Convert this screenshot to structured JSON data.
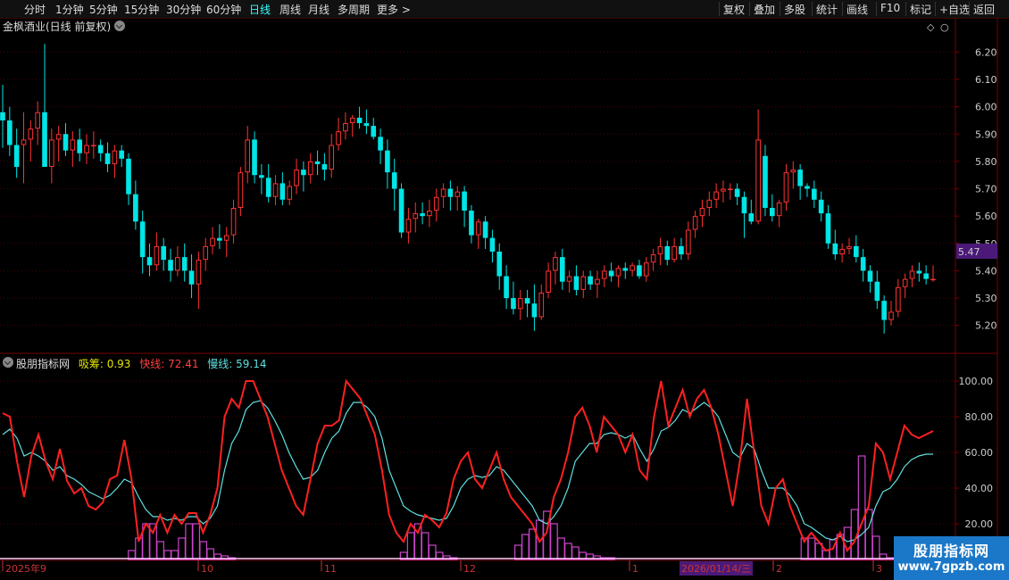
{
  "toolbar": {
    "periods": [
      "分时",
      "1分钟",
      "5分钟",
      "15分钟",
      "30分钟",
      "60分钟",
      "日线",
      "周线",
      "月线",
      "多周期",
      "更多 >"
    ],
    "active_period": "日线",
    "right_buttons": [
      "复权",
      "叠加",
      "多股",
      "统计",
      "画线",
      "F10",
      "标记",
      "+自选",
      "返回"
    ]
  },
  "stock": {
    "title": "金枫酒业(日线 前复权)",
    "current_price_label": "5.47"
  },
  "indicator": {
    "name": "股朋指标网",
    "xichou_label": "吸筹: 0.93",
    "fast_label": "快线: 72.41",
    "slow_label": "慢线: 59.14"
  },
  "x_axis": {
    "labels": [
      "2025年9",
      "10",
      "11",
      "12",
      "1",
      "2",
      "3"
    ],
    "highlight_date": "2026/01/14/三"
  },
  "watermark": {
    "name": "股朋指标网",
    "url": "www.7gpzb.com"
  },
  "colors": {
    "up": "#ff3232",
    "down": "#00e5e5",
    "fast": "#ff2020",
    "slow": "#5fe0e0",
    "xichou": "#cc44cc",
    "grid": "#4a0000"
  },
  "chart_data": [
    {
      "type": "candlestick",
      "title": "金枫酒业(日线 前复权)",
      "y_ticks": [
        5.2,
        5.3,
        5.4,
        5.5,
        5.6,
        5.7,
        5.8,
        5.9,
        6.0,
        6.1,
        6.2
      ],
      "ylim": [
        5.15,
        6.26
      ],
      "candles": [
        [
          5.98,
          6.08,
          5.85,
          5.95
        ],
        [
          5.95,
          6.0,
          5.82,
          5.86
        ],
        [
          5.86,
          5.92,
          5.74,
          5.78
        ],
        [
          5.86,
          5.98,
          5.72,
          5.88
        ],
        [
          5.88,
          5.95,
          5.8,
          5.92
        ],
        [
          5.92,
          6.02,
          5.86,
          5.98
        ],
        [
          5.98,
          6.23,
          5.86,
          5.78
        ],
        [
          5.78,
          5.92,
          5.72,
          5.88
        ],
        [
          5.88,
          5.93,
          5.8,
          5.9
        ],
        [
          5.9,
          5.94,
          5.82,
          5.84
        ],
        [
          5.84,
          5.91,
          5.78,
          5.88
        ],
        [
          5.88,
          5.92,
          5.8,
          5.83
        ],
        [
          5.83,
          5.9,
          5.79,
          5.86
        ],
        [
          5.86,
          5.91,
          5.81,
          5.86
        ],
        [
          5.86,
          5.88,
          5.8,
          5.83
        ],
        [
          5.83,
          5.87,
          5.76,
          5.79
        ],
        [
          5.79,
          5.86,
          5.74,
          5.84
        ],
        [
          5.84,
          5.86,
          5.78,
          5.81
        ],
        [
          5.81,
          5.83,
          5.64,
          5.68
        ],
        [
          5.68,
          5.73,
          5.55,
          5.58
        ],
        [
          5.58,
          5.62,
          5.39,
          5.45
        ],
        [
          5.45,
          5.5,
          5.38,
          5.42
        ],
        [
          5.42,
          5.54,
          5.4,
          5.49
        ],
        [
          5.49,
          5.52,
          5.4,
          5.44
        ],
        [
          5.44,
          5.48,
          5.36,
          5.4
        ],
        [
          5.4,
          5.49,
          5.38,
          5.45
        ],
        [
          5.45,
          5.5,
          5.36,
          5.4
        ],
        [
          5.4,
          5.46,
          5.3,
          5.35
        ],
        [
          5.35,
          5.47,
          5.26,
          5.44
        ],
        [
          5.44,
          5.52,
          5.4,
          5.49
        ],
        [
          5.49,
          5.56,
          5.46,
          5.52
        ],
        [
          5.52,
          5.57,
          5.48,
          5.51
        ],
        [
          5.51,
          5.56,
          5.45,
          5.53
        ],
        [
          5.53,
          5.66,
          5.5,
          5.63
        ],
        [
          5.63,
          5.78,
          5.6,
          5.76
        ],
        [
          5.76,
          5.93,
          5.72,
          5.88
        ],
        [
          5.88,
          5.91,
          5.72,
          5.75
        ],
        [
          5.75,
          5.79,
          5.68,
          5.74
        ],
        [
          5.74,
          5.79,
          5.65,
          5.67
        ],
        [
          5.67,
          5.75,
          5.64,
          5.72
        ],
        [
          5.72,
          5.76,
          5.64,
          5.66
        ],
        [
          5.66,
          5.73,
          5.64,
          5.71
        ],
        [
          5.71,
          5.81,
          5.68,
          5.77
        ],
        [
          5.77,
          5.8,
          5.69,
          5.75
        ],
        [
          5.75,
          5.83,
          5.72,
          5.8
        ],
        [
          5.8,
          5.84,
          5.75,
          5.79
        ],
        [
          5.79,
          5.83,
          5.73,
          5.77
        ],
        [
          5.77,
          5.9,
          5.74,
          5.86
        ],
        [
          5.86,
          5.96,
          5.84,
          5.91
        ],
        [
          5.91,
          5.98,
          5.88,
          5.94
        ],
        [
          5.94,
          5.97,
          5.89,
          5.96
        ],
        [
          5.96,
          6.0,
          5.92,
          5.94
        ],
        [
          5.94,
          5.99,
          5.9,
          5.93
        ],
        [
          5.93,
          5.96,
          5.88,
          5.89
        ],
        [
          5.89,
          5.92,
          5.79,
          5.84
        ],
        [
          5.84,
          5.88,
          5.7,
          5.76
        ],
        [
          5.76,
          5.81,
          5.62,
          5.7
        ],
        [
          5.7,
          5.72,
          5.52,
          5.54
        ],
        [
          5.54,
          5.63,
          5.5,
          5.59
        ],
        [
          5.59,
          5.65,
          5.54,
          5.61
        ],
        [
          5.61,
          5.65,
          5.57,
          5.6
        ],
        [
          5.6,
          5.66,
          5.56,
          5.62
        ],
        [
          5.62,
          5.7,
          5.58,
          5.67
        ],
        [
          5.67,
          5.72,
          5.63,
          5.7
        ],
        [
          5.7,
          5.73,
          5.62,
          5.67
        ],
        [
          5.67,
          5.71,
          5.62,
          5.69
        ],
        [
          5.69,
          5.71,
          5.56,
          5.62
        ],
        [
          5.62,
          5.64,
          5.5,
          5.53
        ],
        [
          5.53,
          5.59,
          5.48,
          5.58
        ],
        [
          5.58,
          5.6,
          5.48,
          5.52
        ],
        [
          5.52,
          5.55,
          5.43,
          5.47
        ],
        [
          5.47,
          5.5,
          5.33,
          5.38
        ],
        [
          5.38,
          5.42,
          5.26,
          5.3
        ],
        [
          5.3,
          5.36,
          5.24,
          5.26
        ],
        [
          5.26,
          5.33,
          5.22,
          5.3
        ],
        [
          5.3,
          5.33,
          5.23,
          5.28
        ],
        [
          5.28,
          5.35,
          5.18,
          5.23
        ],
        [
          5.23,
          5.35,
          5.22,
          5.32
        ],
        [
          5.32,
          5.43,
          5.3,
          5.4
        ],
        [
          5.4,
          5.47,
          5.35,
          5.45
        ],
        [
          5.45,
          5.48,
          5.33,
          5.36
        ],
        [
          5.36,
          5.4,
          5.32,
          5.38
        ],
        [
          5.38,
          5.42,
          5.31,
          5.33
        ],
        [
          5.33,
          5.4,
          5.3,
          5.38
        ],
        [
          5.38,
          5.4,
          5.33,
          5.35
        ],
        [
          5.35,
          5.4,
          5.3,
          5.37
        ],
        [
          5.37,
          5.42,
          5.34,
          5.4
        ],
        [
          5.4,
          5.43,
          5.36,
          5.38
        ],
        [
          5.38,
          5.42,
          5.34,
          5.41
        ],
        [
          5.41,
          5.43,
          5.37,
          5.4
        ],
        [
          5.4,
          5.43,
          5.38,
          5.42
        ],
        [
          5.42,
          5.44,
          5.37,
          5.38
        ],
        [
          5.38,
          5.45,
          5.36,
          5.43
        ],
        [
          5.43,
          5.48,
          5.4,
          5.46
        ],
        [
          5.46,
          5.52,
          5.42,
          5.49
        ],
        [
          5.49,
          5.51,
          5.42,
          5.44
        ],
        [
          5.44,
          5.52,
          5.43,
          5.49
        ],
        [
          5.49,
          5.52,
          5.44,
          5.46
        ],
        [
          5.46,
          5.58,
          5.44,
          5.55
        ],
        [
          5.55,
          5.62,
          5.52,
          5.6
        ],
        [
          5.6,
          5.66,
          5.56,
          5.63
        ],
        [
          5.63,
          5.69,
          5.6,
          5.66
        ],
        [
          5.66,
          5.72,
          5.63,
          5.69
        ],
        [
          5.69,
          5.73,
          5.65,
          5.7
        ],
        [
          5.7,
          5.72,
          5.66,
          5.7
        ],
        [
          5.7,
          5.72,
          5.64,
          5.67
        ],
        [
          5.67,
          5.69,
          5.52,
          5.61
        ],
        [
          5.61,
          5.66,
          5.57,
          5.58
        ],
        [
          5.58,
          5.99,
          5.57,
          5.88
        ],
        [
          5.82,
          5.86,
          5.6,
          5.63
        ],
        [
          5.63,
          5.68,
          5.58,
          5.6
        ],
        [
          5.6,
          5.66,
          5.56,
          5.65
        ],
        [
          5.65,
          5.79,
          5.62,
          5.76
        ],
        [
          5.76,
          5.8,
          5.7,
          5.77
        ],
        [
          5.77,
          5.79,
          5.66,
          5.71
        ],
        [
          5.71,
          5.72,
          5.67,
          5.7
        ],
        [
          5.7,
          5.73,
          5.63,
          5.66
        ],
        [
          5.66,
          5.69,
          5.58,
          5.61
        ],
        [
          5.61,
          5.64,
          5.48,
          5.5
        ],
        [
          5.5,
          5.55,
          5.44,
          5.46
        ],
        [
          5.46,
          5.5,
          5.43,
          5.48
        ],
        [
          5.48,
          5.52,
          5.46,
          5.49
        ],
        [
          5.49,
          5.53,
          5.43,
          5.45
        ],
        [
          5.45,
          5.48,
          5.36,
          5.4
        ],
        [
          5.4,
          5.42,
          5.32,
          5.36
        ],
        [
          5.36,
          5.4,
          5.26,
          5.29
        ],
        [
          5.29,
          5.31,
          5.17,
          5.22
        ],
        [
          5.22,
          5.29,
          5.2,
          5.25
        ],
        [
          5.25,
          5.37,
          5.23,
          5.34
        ],
        [
          5.34,
          5.39,
          5.3,
          5.37
        ],
        [
          5.37,
          5.42,
          5.34,
          5.4
        ],
        [
          5.4,
          5.43,
          5.36,
          5.39
        ],
        [
          5.39,
          5.42,
          5.35,
          5.37
        ],
        [
          5.37,
          5.42,
          5.36,
          5.37
        ]
      ]
    },
    {
      "type": "line",
      "title": "股朋指标网",
      "y_ticks": [
        20,
        40,
        60,
        80,
        100
      ],
      "ylim": [
        0,
        105
      ],
      "series": [
        {
          "name": "快线",
          "values": [
            82,
            80,
            55,
            35,
            58,
            70,
            55,
            45,
            62,
            44,
            37,
            40,
            30,
            28,
            32,
            45,
            47,
            67,
            45,
            10,
            20,
            15,
            25,
            15,
            25,
            20,
            26,
            26,
            15,
            25,
            40,
            80,
            90,
            85,
            100,
            100,
            90,
            80,
            65,
            50,
            40,
            30,
            25,
            45,
            65,
            75,
            75,
            78,
            100,
            95,
            90,
            80,
            70,
            50,
            25,
            15,
            10,
            20,
            15,
            25,
            22,
            18,
            26,
            45,
            55,
            60,
            45,
            40,
            50,
            60,
            45,
            35,
            30,
            25,
            20,
            10,
            15,
            35,
            45,
            60,
            80,
            85,
            75,
            60,
            80,
            75,
            70,
            60,
            70,
            50,
            45,
            80,
            100,
            75,
            85,
            95,
            80,
            90,
            95,
            85,
            70,
            50,
            30,
            55,
            90,
            60,
            30,
            20,
            40,
            45,
            30,
            20,
            10,
            15,
            10,
            5,
            6,
            15,
            5,
            10,
            20,
            30,
            65,
            60,
            45,
            60,
            75,
            70,
            68,
            70,
            72
          ]
        },
        {
          "name": "慢线",
          "values": [
            70,
            73,
            68,
            58,
            60,
            58,
            55,
            50,
            52,
            47,
            45,
            42,
            38,
            36,
            34,
            36,
            40,
            45,
            43,
            35,
            28,
            24,
            24,
            22,
            23,
            22,
            24,
            24,
            20,
            23,
            30,
            50,
            65,
            72,
            84,
            88,
            89,
            85,
            78,
            70,
            60,
            52,
            45,
            46,
            50,
            60,
            68,
            72,
            82,
            88,
            88,
            85,
            80,
            68,
            50,
            40,
            30,
            27,
            25,
            24,
            23,
            22,
            23,
            30,
            40,
            45,
            47,
            46,
            47,
            52,
            50,
            45,
            40,
            35,
            30,
            22,
            20,
            24,
            30,
            40,
            55,
            60,
            65,
            65,
            70,
            71,
            70,
            68,
            70,
            62,
            55,
            62,
            72,
            74,
            78,
            84,
            82,
            85,
            88,
            85,
            80,
            70,
            60,
            57,
            65,
            62,
            50,
            40,
            40,
            40,
            36,
            30,
            20,
            18,
            15,
            12,
            11,
            13,
            10,
            11,
            14,
            18,
            30,
            38,
            40,
            45,
            52,
            56,
            58,
            59,
            59
          ]
        },
        {
          "name": "吸筹",
          "type": "bar",
          "values": [
            0,
            0,
            0,
            0,
            0,
            0,
            0,
            0,
            0,
            0,
            0,
            0,
            0,
            0,
            0,
            0,
            0,
            0,
            5,
            12,
            20,
            20,
            10,
            5,
            5,
            12,
            20,
            20,
            10,
            6,
            3,
            2,
            1,
            0,
            0,
            0,
            0,
            0,
            0,
            0,
            0,
            0,
            0,
            0,
            0,
            0,
            0,
            0,
            0,
            0,
            0,
            0,
            0,
            0,
            0,
            0,
            4,
            15,
            20,
            15,
            8,
            4,
            2,
            1,
            0,
            0,
            0,
            0,
            0,
            0,
            0,
            0,
            8,
            14,
            17,
            22,
            27,
            20,
            12,
            9,
            7,
            4,
            3,
            2,
            1,
            1,
            0,
            0,
            0,
            0,
            0,
            0,
            0,
            0,
            0,
            0,
            0,
            0,
            0,
            0,
            0,
            0,
            0,
            0,
            0,
            0,
            0,
            0,
            0,
            0,
            0,
            0,
            12,
            12,
            9,
            5,
            11,
            14,
            18,
            28,
            58,
            28,
            13,
            3,
            1,
            0,
            0,
            0,
            0,
            0,
            0
          ]
        }
      ]
    }
  ]
}
